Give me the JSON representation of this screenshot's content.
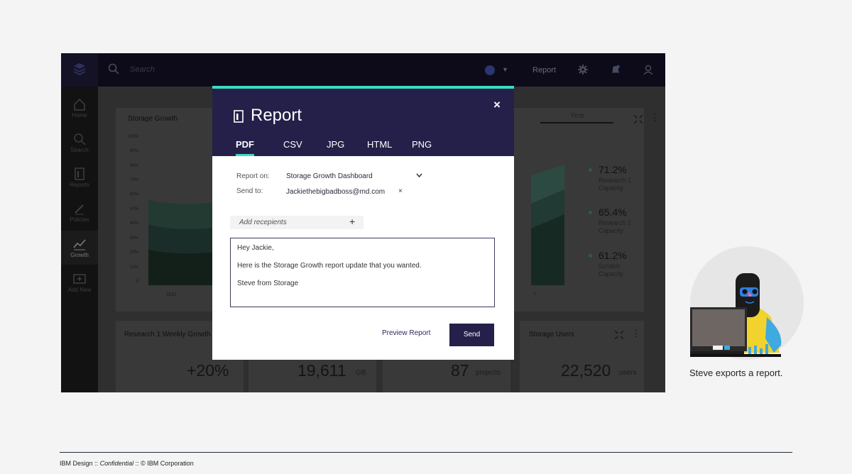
{
  "app": {
    "topbar": {
      "search_placeholder": "Search",
      "report_label": "Report",
      "icons": [
        "ibm-logo-icon",
        "search-icon",
        "globe-icon",
        "chevron-down-icon",
        "settings-icon",
        "notification-icon",
        "user-icon"
      ]
    },
    "sidebar": {
      "items": [
        {
          "label": "Home",
          "icon": "home-icon"
        },
        {
          "label": "Search",
          "icon": "search-icon"
        },
        {
          "label": "Reports",
          "icon": "reports-icon"
        },
        {
          "label": "Policies",
          "icon": "pencil-icon"
        },
        {
          "label": "Growth",
          "icon": "growth-chart-icon",
          "active": true
        },
        {
          "label": "Add New",
          "icon": "add-new-icon"
        }
      ]
    },
    "dashboard": {
      "storage_growth_title": "Storage Growth",
      "period_tab": "Year",
      "y_ticks": [
        "100%",
        "90%",
        "80%",
        "70%",
        "60%",
        "50%",
        "40%",
        "30%",
        "20%",
        "10%",
        "0"
      ],
      "x_ticks": [
        "2011",
        "7"
      ],
      "legend": [
        {
          "pct": "71.2%",
          "label": "Research 1\nCapacity"
        },
        {
          "pct": "65.4%",
          "label": "Research 2\nCapacity"
        },
        {
          "pct": "61.2%",
          "label": "Scratch\nCapacity"
        }
      ],
      "cards": [
        {
          "title": "Research 1 Weekly Growth",
          "value": "+20%",
          "unit": ""
        },
        {
          "title": "",
          "value": "19,611",
          "unit": "GB"
        },
        {
          "title": "",
          "value": "87",
          "unit": "projects"
        },
        {
          "title": "Storage Users",
          "value": "22,520",
          "unit": "users"
        }
      ]
    }
  },
  "modal": {
    "title": "Report",
    "close": "×",
    "tabs": [
      "PDF",
      "CSV",
      "JPG",
      "HTML",
      "PNG"
    ],
    "active_tab": "PDF",
    "report_on_label": "Report on:",
    "report_on_value": "Storage Growth Dashboard",
    "send_to_label": "Send to:",
    "send_to_value": "Jackiethebigbadboss@md.com",
    "remove": "×",
    "add_recipients_placeholder": "Add recepients",
    "add_plus": "+",
    "message_lines": [
      "Hey Jackie,",
      "Here is the Storage Growth report update that you wanted.",
      "Steve from Storage"
    ],
    "preview_label": "Preview Report",
    "send_label": "Send",
    "accent_color": "#3ddbc0",
    "header_color": "#24204a"
  },
  "caption": "Steve exports a report.",
  "footer": {
    "brand": "IBM Design",
    "sep1": "::",
    "confidential": "Confidential",
    "sep2": "::",
    "copyright": "© IBM Corporation"
  }
}
